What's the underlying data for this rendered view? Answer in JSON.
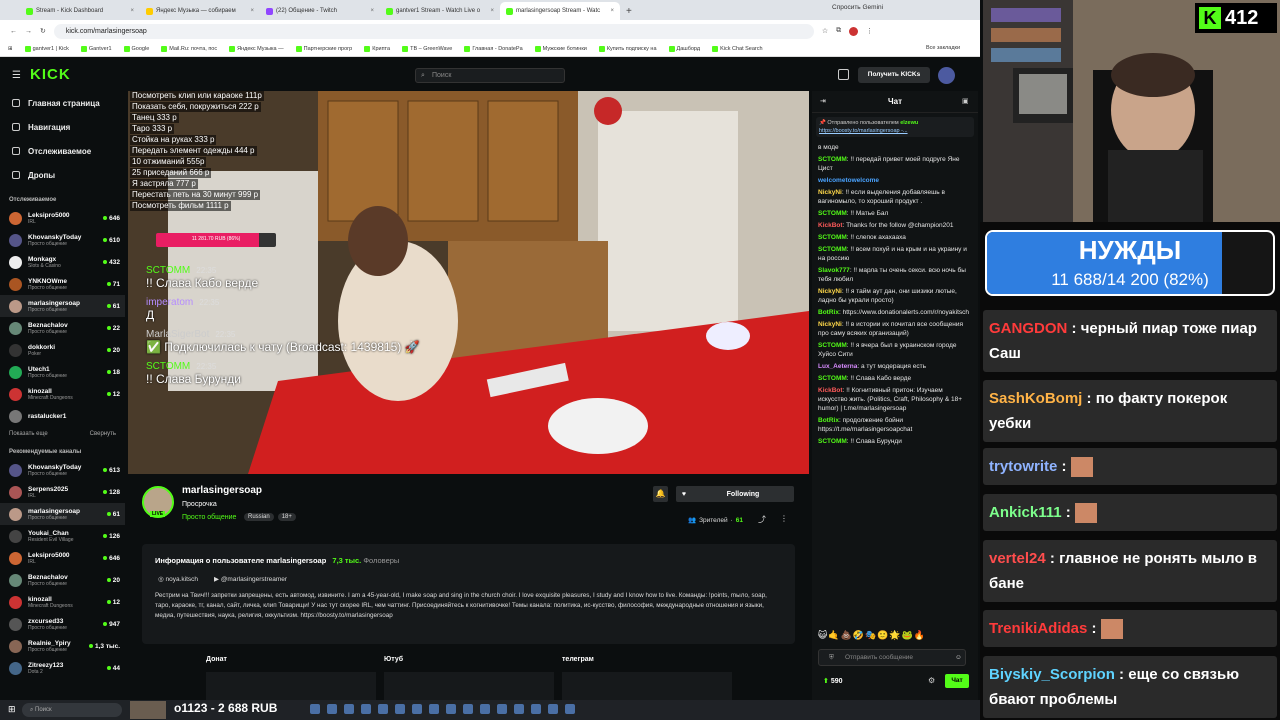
{
  "browser": {
    "tabs": [
      {
        "label": "Stream - Kick Dashboard",
        "color": "#53fc18",
        "active": false
      },
      {
        "label": "Яндекс Музыка — собираем",
        "color": "#ffcc00",
        "active": false
      },
      {
        "label": "(22) Общение - Twitch",
        "color": "#9146ff",
        "active": false
      },
      {
        "label": "gantver1 Stream - Watch Live o",
        "color": "#53fc18",
        "active": false
      },
      {
        "label": "marlasingersoap Stream - Watc",
        "color": "#53fc18",
        "active": true
      }
    ],
    "gemini": "Спросить Gemini",
    "url": "kick.com/marlasingersoap",
    "bookmarks": [
      "gantver1 | Kick",
      "Gantver1",
      "Google",
      "Mail.Ru: почта, пос",
      "Яндекс Музыка —",
      "Партнерские прогр",
      "Крипта",
      "TB – GreenWave",
      "Главная - DonatePa",
      "Мужские ботинки",
      "Купить подписку на",
      "Дашборд",
      "Kick Chat Search"
    ],
    "all_bookmarks": "Все закладки"
  },
  "header": {
    "logo": "KICK",
    "search_placeholder": "Поиск",
    "get_kicks": "Получить KICKs"
  },
  "nav": {
    "items": [
      "Главная страница",
      "Навигация",
      "Отслеживаемое",
      "Дропы"
    ]
  },
  "following": {
    "title": "Отслеживаемое",
    "channels": [
      {
        "name": "Leksipro5000",
        "sub": "IRL",
        "count": "646",
        "color": "#c63"
      },
      {
        "name": "KhovanskyToday",
        "sub": "Просто общение",
        "count": "610",
        "color": "#558"
      },
      {
        "name": "Monkagx",
        "sub": "Slots & Casino",
        "count": "432",
        "color": "#eee"
      },
      {
        "name": "YNKNOWme",
        "sub": "Просто общение",
        "count": "71",
        "color": "#a52"
      },
      {
        "name": "marlasingersoap",
        "sub": "Просто общение",
        "count": "61",
        "color": "#b98"
      },
      {
        "name": "Beznachalov",
        "sub": "Просто общение",
        "count": "22",
        "color": "#687"
      },
      {
        "name": "dokkorki",
        "sub": "Poker",
        "count": "20",
        "color": "#333"
      },
      {
        "name": "Utech1",
        "sub": "Просто общение",
        "count": "18",
        "color": "#2a5"
      },
      {
        "name": "kinozall",
        "sub": "Minecraft Dungeons",
        "count": "12",
        "color": "#c33"
      },
      {
        "name": "rastalucker1",
        "sub": "",
        "count": "",
        "color": "#777"
      }
    ],
    "show_more": "Показать еще",
    "collapse": "Свернуть"
  },
  "recommended": {
    "title": "Рекомендуемые каналы",
    "channels": [
      {
        "name": "KhovanskyToday",
        "sub": "Просто общение",
        "count": "613",
        "color": "#558"
      },
      {
        "name": "Serpens2025",
        "sub": "IRL",
        "count": "128",
        "color": "#a55"
      },
      {
        "name": "marlasingersoap",
        "sub": "Просто общение",
        "count": "61",
        "color": "#b98"
      },
      {
        "name": "Youkai_Chan",
        "sub": "Resident Evil Village",
        "count": "126",
        "color": "#444"
      },
      {
        "name": "Leksipro5000",
        "sub": "IRL",
        "count": "646",
        "color": "#c63"
      },
      {
        "name": "Beznachalov",
        "sub": "Просто общение",
        "count": "20",
        "color": "#687"
      },
      {
        "name": "kinozall",
        "sub": "Minecraft Dungeons",
        "count": "12",
        "color": "#c33"
      },
      {
        "name": "zxcursed33",
        "sub": "Просто общение",
        "count": "947",
        "color": "#555"
      },
      {
        "name": "Realnie_Ypiry",
        "sub": "Просто общение",
        "count": "1,3 тыс.",
        "color": "#865"
      },
      {
        "name": "Zitreezy123",
        "sub": "Dota 2",
        "count": "44",
        "color": "#468"
      }
    ]
  },
  "video": {
    "price_list": [
      "Посмотреть клип или караоке 111р",
      "Показать себя, покружиться 222 р",
      "Танец 333 р",
      "Таро 333 р",
      "Стойка на руках 333 р",
      "Передать элемент одежды 444 р",
      "10 отжиманий 555р",
      "25 приседаний 666 р",
      "Я застряла 777 р",
      "Перестать петь на 30 минут 999 р",
      "Посмотреть фильм 1111 р"
    ],
    "goal_bar_text": "11 281.70 RUB (86%)",
    "goal_percent": 86,
    "overlay_chat": [
      {
        "user": "SCTOMM",
        "time": "22:35",
        "text": "!! Слава Кабо верде",
        "color": "#53fc18"
      },
      {
        "user": "imperatom",
        "time": "22:35",
        "text": "Д",
        "color": "#b58cff"
      },
      {
        "user": "MarlaSigerBot",
        "time": "22:35",
        "text": "✅ Подключилась к чату (Broadcast: 1439815) 🚀",
        "color": "#cccccc"
      },
      {
        "user": "SCTOMM",
        "time": "22:35",
        "text": "!! Слава Бурунди",
        "color": "#53fc18"
      }
    ]
  },
  "stream": {
    "channel": "marlasingersoap",
    "title": "Просрочка",
    "category": "Просто общение",
    "tags": [
      "Russian",
      "18+"
    ],
    "following_label": "Following",
    "viewers_label": "Зрителей",
    "viewers": "61",
    "about_title": "Информация о пользователе marlasingersoap",
    "followers": "7,3 тыс.",
    "followers_label": "Фоловеры",
    "instagram": "noya.kitsch",
    "youtube": "@marlasingerstreamer",
    "description": "Рестрим на Твич!!! запретки запрещены, есть автомод, извините. I am a 45-year-old, I make soap and sing in the church choir. I love exquisite pleasures, I study and I know how to live. Команды: !points, mыло, soap, таро, караоке, тг, канал, сайт, личка, клип Товарищи! У нас тут скорее IRL, чем чаттинг. Присоединяйтесь к когнитивочке! Темы канала: политика, ис-кусство, философия, международные отношения и языки, медиа, путешествия, наука, религия, оккультизм. https://boosty.to/marlasingersoap",
    "panels": [
      "Донат",
      "Ютуб",
      "телеграм"
    ]
  },
  "chat": {
    "title": "Чат",
    "pinned_by": "Отправлено пользователем",
    "pinned_user": "elzewu",
    "pinned_link": "https://boosty.to/marlasingersoap -...",
    "messages": [
      {
        "user": "",
        "text": "в моде",
        "color": "#ffffff"
      },
      {
        "user": "SCTOMM",
        "text": "!! передай привет моей подруге Яне Цист",
        "color": "#53fc18"
      },
      {
        "user": "welcometowelcome",
        "text": "",
        "color": "#4aa3ff"
      },
      {
        "user": "NickyNi",
        "text": "!! если выделения добавляешь в вагиномыло, то хороший продукт .",
        "color": "#ffd84a"
      },
      {
        "user": "SCTOMM",
        "text": "!! Матье Бал",
        "color": "#53fc18"
      },
      {
        "user": "KickBot",
        "text": "Thanks for the follow @champion201",
        "color": "#ff5a5a"
      },
      {
        "user": "SCTOMM",
        "text": "!! слепок ахахааха",
        "color": "#53fc18"
      },
      {
        "user": "SCTOMM",
        "text": "!! всем похуй и на крым и на украину и на россию",
        "color": "#53fc18"
      },
      {
        "user": "Slavok777",
        "text": "!! марла ты очень секси. всю ночь бы тебя любил",
        "color": "#53fc18"
      },
      {
        "user": "NickyNi",
        "text": "!! я тайм аут дан, они шизики лютые, ладно бы украли просто)",
        "color": "#ffd84a"
      },
      {
        "user": "BotRix",
        "text": "https://www.donationalerts.com/r/noyakitsch",
        "color": "#53fc18"
      },
      {
        "user": "NickyNi",
        "text": "!! в истории их почитал все сообщения про саму всяких организаций)",
        "color": "#ffd84a"
      },
      {
        "user": "SCTOMM",
        "text": "!! я вчера был в украинском городе Хуйсо Сити",
        "color": "#53fc18"
      },
      {
        "user": "Lux_Aeterna",
        "text": "а тут модерация есть",
        "color": "#d88cff"
      },
      {
        "user": "SCTOMM",
        "text": "!! Слава Кабо верде",
        "color": "#53fc18"
      },
      {
        "user": "KickBot",
        "text": "!! Когнитивный притон: Изучаем искусство жить. (Politics, Craft, Philosophy & 18+ humor) | t.me/marlasingersoap",
        "color": "#ff5a5a"
      },
      {
        "user": "BotRix",
        "text": "продолжение бойни https://t.me/marlasingersoapchat",
        "color": "#53fc18"
      },
      {
        "user": "SCTOMM",
        "text": "!! Слава Бурунди",
        "color": "#53fc18"
      }
    ],
    "input_placeholder": "Отправить сообщение",
    "points": "590",
    "send_label": "Чат"
  },
  "taskbar": {
    "ticker": "o1123 - 2 688 RUB"
  },
  "overlay": {
    "counter": "412",
    "goal_title": "НУЖДЫ",
    "goal_value": "11 688/14 200 (82%)",
    "goal_percent": 82,
    "messages": [
      {
        "user": "GANGDON",
        "text": "черный пиар тоже пиар Саш",
        "color": "#ff3b3b"
      },
      {
        "user": "SashKoBomj",
        "text": "по факту покерок уебки",
        "color": "#ffb347"
      },
      {
        "user": "trytowrite",
        "text": "",
        "color": "#8fb3ff"
      },
      {
        "user": "Ankick111",
        "text": "",
        "color": "#7dff8c"
      },
      {
        "user": "vertel24",
        "text": "главное не ронять мыло в бане",
        "color": "#ff4d4d"
      },
      {
        "user": "TrenikiAdidas",
        "text": "",
        "color": "#ff3b3b"
      },
      {
        "user": "Biyskiy_Scorpion",
        "text": "еще со связью бвают проблемы",
        "color": "#5fd3ff"
      }
    ]
  }
}
